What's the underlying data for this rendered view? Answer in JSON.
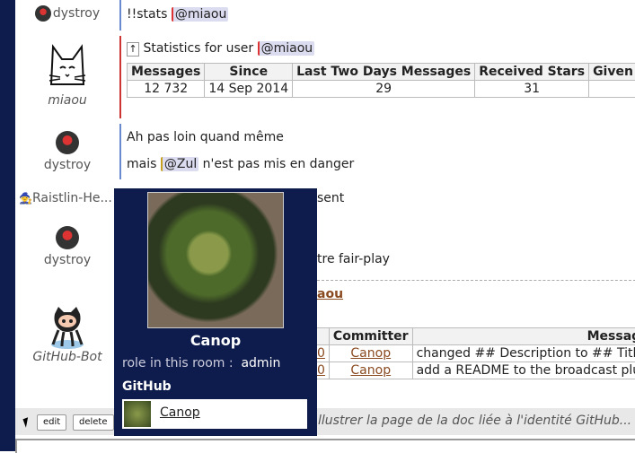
{
  "messages": [
    {
      "user": "dystroy",
      "text_before": "!!stats ",
      "ping": "@miaou"
    },
    {
      "user": "miaou",
      "title_prefix": "Statistics for user ",
      "ping": "@miaou"
    },
    {
      "user": "dystroy",
      "line1": "Ah pas loin quand même",
      "line2_before": "mais ",
      "ping": "@Zul",
      "line2_after": " n'est pas mis en danger"
    },
    {
      "user": "Raistlin-He...",
      "text": "sent"
    },
    {
      "user": "dystroy",
      "text": "tre fair-play",
      "link": "aou"
    },
    {
      "user": "GitHub-Bot"
    }
  ],
  "stats_table": {
    "headers": [
      "Messages",
      "Since",
      "Last Two Days Messages",
      "Received Stars",
      "Given S"
    ],
    "row": [
      "12 732",
      "14 Sep 2014",
      "29",
      "31",
      ""
    ]
  },
  "commits_table": {
    "headers": [
      "Committer",
      "Messag"
    ],
    "rows": [
      {
        "hash": "0",
        "committer": "Canop",
        "message": "changed ## Description to ## Titl"
      },
      {
        "hash": "0",
        "committer": "Canop",
        "message": "add a README to the broadcast plu"
      }
    ]
  },
  "popup": {
    "name": "Canop",
    "role_label": "role in this room :",
    "role_value": "admin",
    "github_label": "GitHub",
    "github_user": "Canop"
  },
  "actions": {
    "edit": "edit",
    "delete": "delete"
  },
  "bottom_text": "llustrer la page de la doc liée à l'identité GitHub..."
}
